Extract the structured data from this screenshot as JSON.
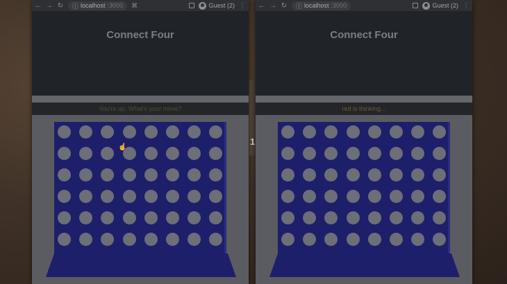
{
  "windows": [
    {
      "address": {
        "host": "localhost",
        "port": ":3000"
      },
      "profile_label": "Guest (2)",
      "page_title": "Connect Four",
      "status_text": "You're up. What's your move?",
      "board": {
        "columns": 8,
        "rows": 6
      }
    },
    {
      "address": {
        "host": "localhost",
        "port": ":3000"
      },
      "profile_label": "Guest (2)",
      "page_title": "Connect Four",
      "status_text": "red is thinking...",
      "board": {
        "columns": 8,
        "rows": 6
      }
    }
  ],
  "split_label": "1",
  "colors": {
    "board": "#1d1f6b",
    "empty_cell": "#6c6e78",
    "page_header": "#202328"
  },
  "icons": [
    "back-arrow-icon",
    "forward-arrow-icon",
    "reload-icon",
    "info-icon",
    "extension-icon",
    "sidepanel-icon",
    "profile-icon",
    "menu-kebab-icon",
    "hand-cursor-icon"
  ]
}
